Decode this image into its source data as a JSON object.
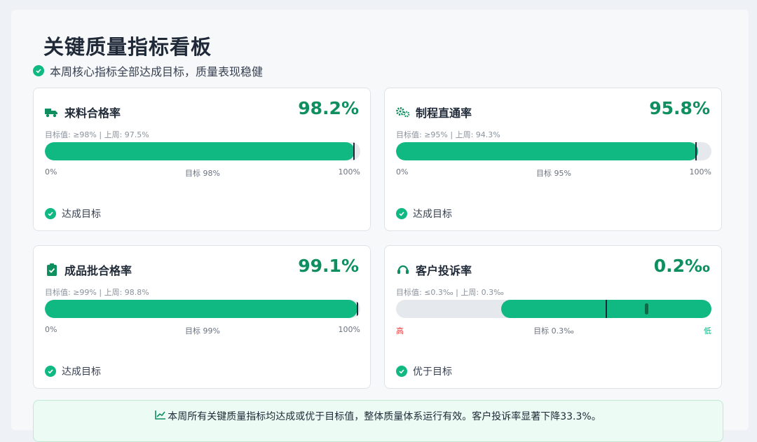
{
  "title": "关键质量指标看板",
  "subtitle": "本周核心指标全部达成目标，质量表现稳健",
  "colors": {
    "accent": "#10b981",
    "value": "#0f8f5f",
    "high": "#ef4444",
    "low": "#10b981"
  },
  "cards": [
    {
      "icon": "truck-icon",
      "name": "来料合格率",
      "value": "98.2%",
      "meta": "目标值: ≥98% | 上周: 97.5%",
      "progress_percent": 98.2,
      "target_percent": 98,
      "scale_left": "0%",
      "scale_center": "目标 98%",
      "scale_right": "100%",
      "status": "达成目标"
    },
    {
      "icon": "gears-icon",
      "name": "制程直通率",
      "value": "95.8%",
      "meta": "目标值: ≥95% | 上周: 94.3%",
      "progress_percent": 95.8,
      "target_percent": 95,
      "scale_left": "0%",
      "scale_center": "目标 95%",
      "scale_right": "100%",
      "status": "达成目标"
    },
    {
      "icon": "clipboard-check-icon",
      "name": "成品批合格率",
      "value": "99.1%",
      "meta": "目标值: ≥99% | 上周: 98.8%",
      "progress_percent": 99.1,
      "target_percent": 99,
      "scale_left": "0%",
      "scale_center": "目标 99%",
      "scale_right": "100%",
      "status": "达成目标"
    },
    {
      "icon": "headset-icon",
      "name": "客户投诉率",
      "value": "0.2‰",
      "meta": "目标值: ≤0.3‰ | 上周: 0.3‰",
      "progress_percent": 66.7,
      "target_percent": 66.7,
      "current_marker_percent": 79.3,
      "scale_left": "高",
      "scale_center": "目标 0.3‰",
      "scale_right": "低",
      "status": "优于目标"
    }
  ],
  "summary": "本周所有关键质量指标均达成或优于目标值，整体质量体系运行有效。客户投诉率显著下降33.3%。"
}
